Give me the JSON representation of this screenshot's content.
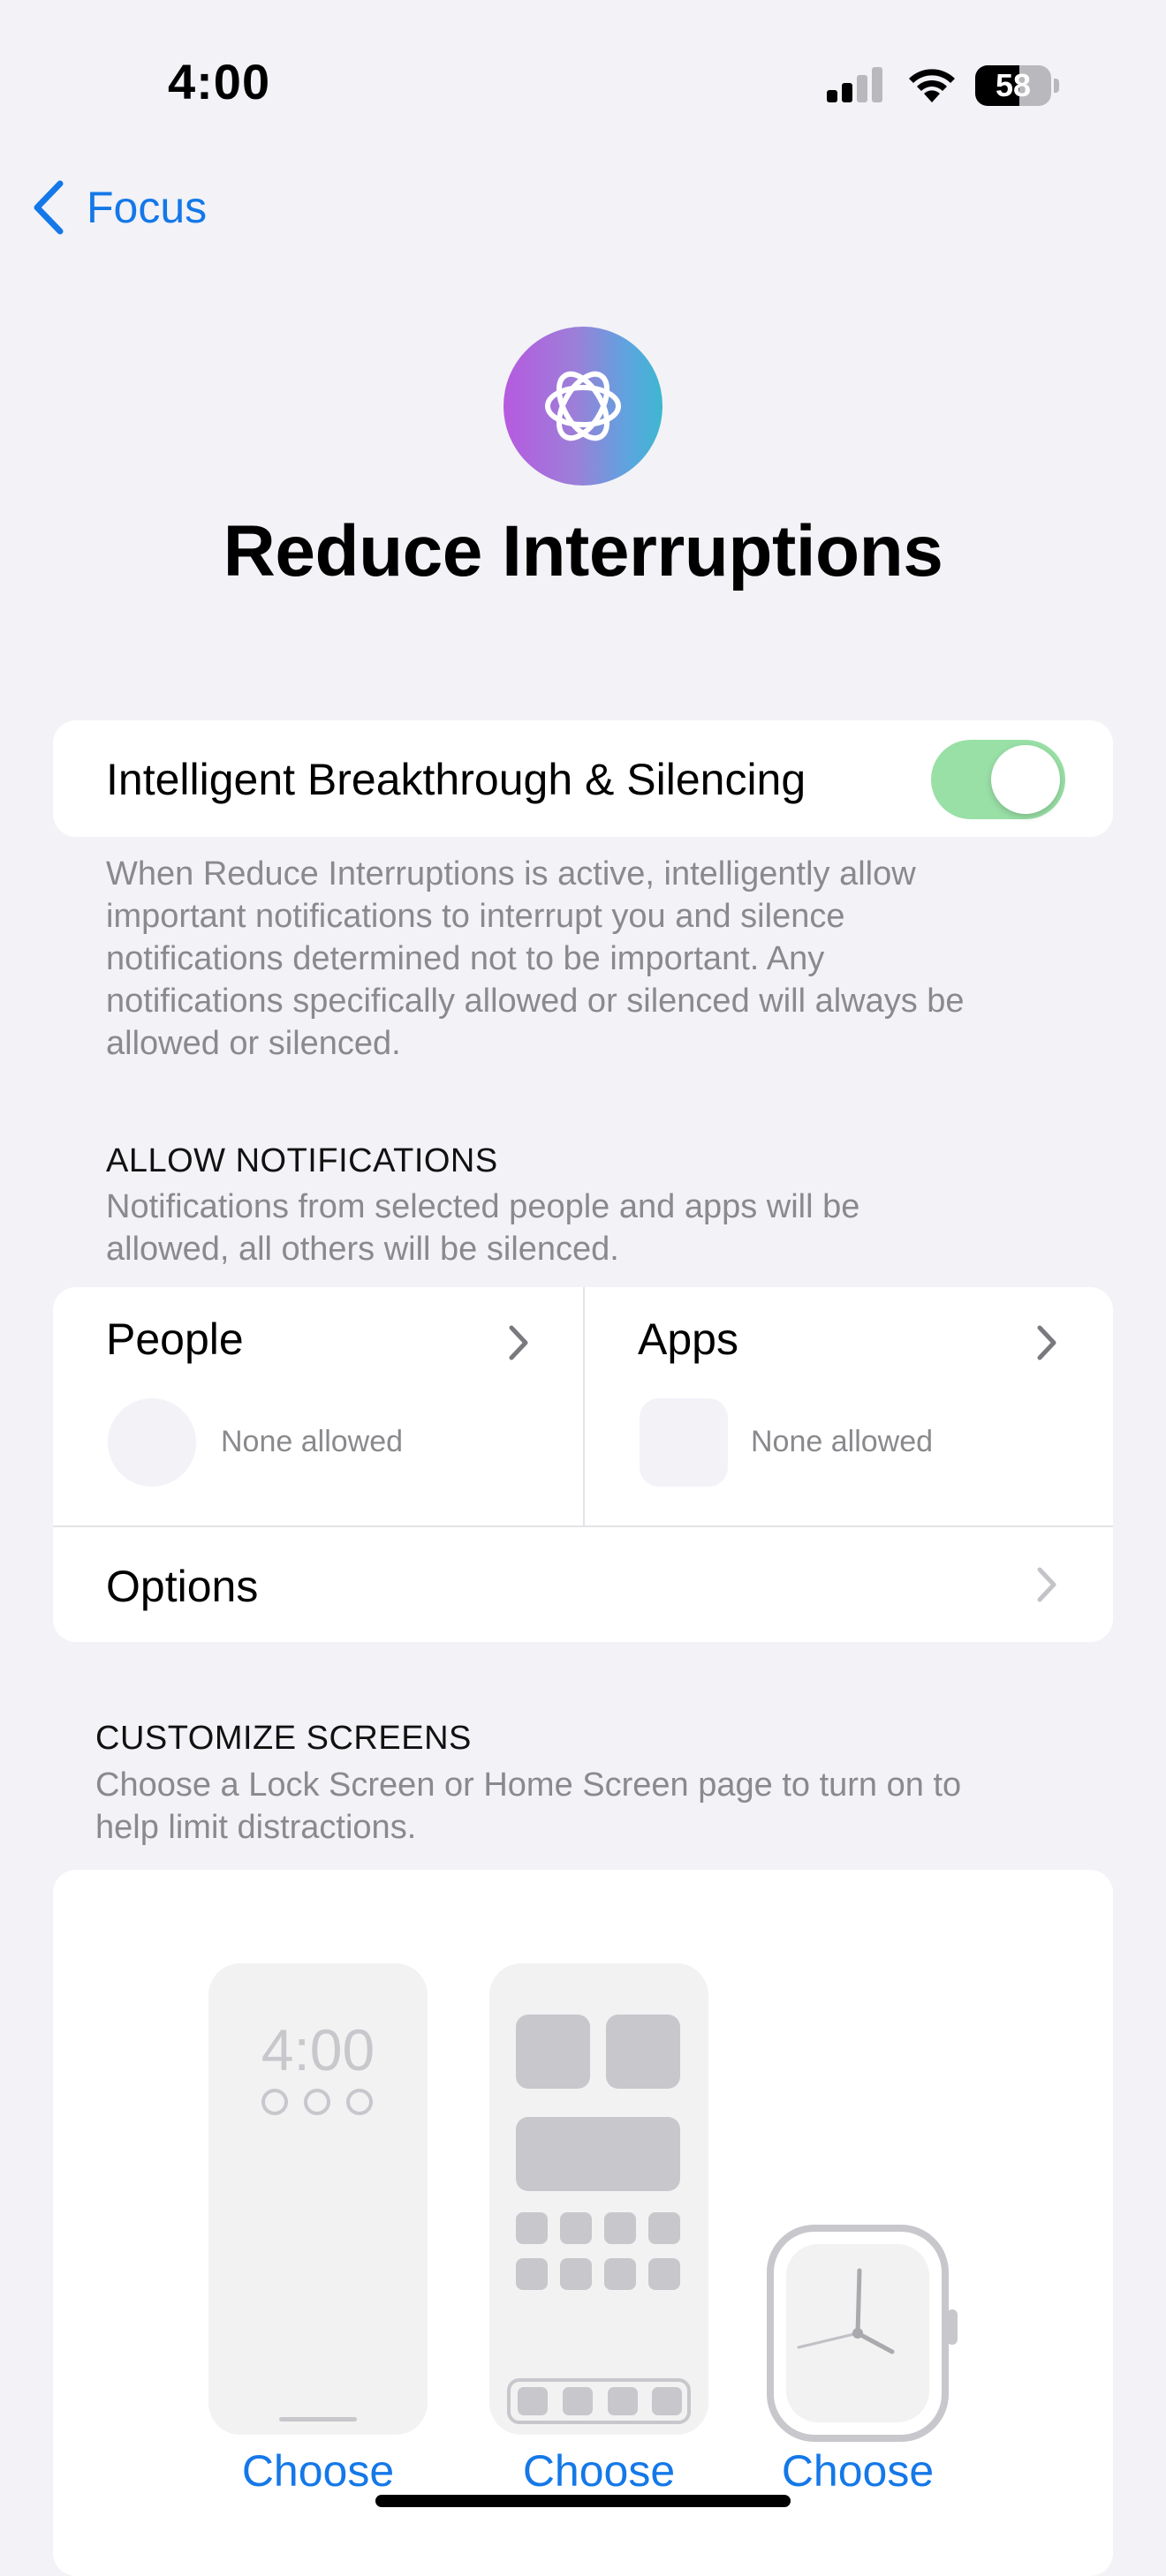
{
  "status_bar": {
    "time": "4:00",
    "battery_percent": 58,
    "battery_label": "58",
    "signal_bars": 2
  },
  "nav": {
    "back_label": "Focus"
  },
  "header": {
    "title": "Reduce Interruptions",
    "accent": "#9c7fd8"
  },
  "breakthrough": {
    "label": "Intelligent Breakthrough & Silencing",
    "enabled": true,
    "footer_lines": [
      "When Reduce Interruptions is active, intelligently allow",
      "important notifications to interrupt you and silence",
      "notifications determined not to be important. Any",
      "notifications specifically allowed or silenced will always be",
      "allowed or silenced."
    ]
  },
  "allow_notifications": {
    "header": "ALLOW NOTIFICATIONS",
    "desc_lines": [
      "Notifications from selected people and apps will be",
      "allowed, all others will be silenced."
    ],
    "people": {
      "title": "People",
      "status": "None allowed"
    },
    "apps": {
      "title": "Apps",
      "status": "None allowed"
    },
    "options": {
      "title": "Options"
    }
  },
  "customize_screens": {
    "header": "CUSTOMIZE SCREENS",
    "desc_lines": [
      "Choose a Lock Screen or Home Screen page to turn on to",
      "help limit distractions."
    ],
    "lock_time": "4:00",
    "choose_lock": "Choose",
    "choose_home": "Choose",
    "choose_watch": "Choose"
  },
  "colors": {
    "link": "#1478e8",
    "toggle_on": "#99e0a6",
    "background": "#f2f2f7",
    "secondary_text": "#8a8a8e"
  }
}
